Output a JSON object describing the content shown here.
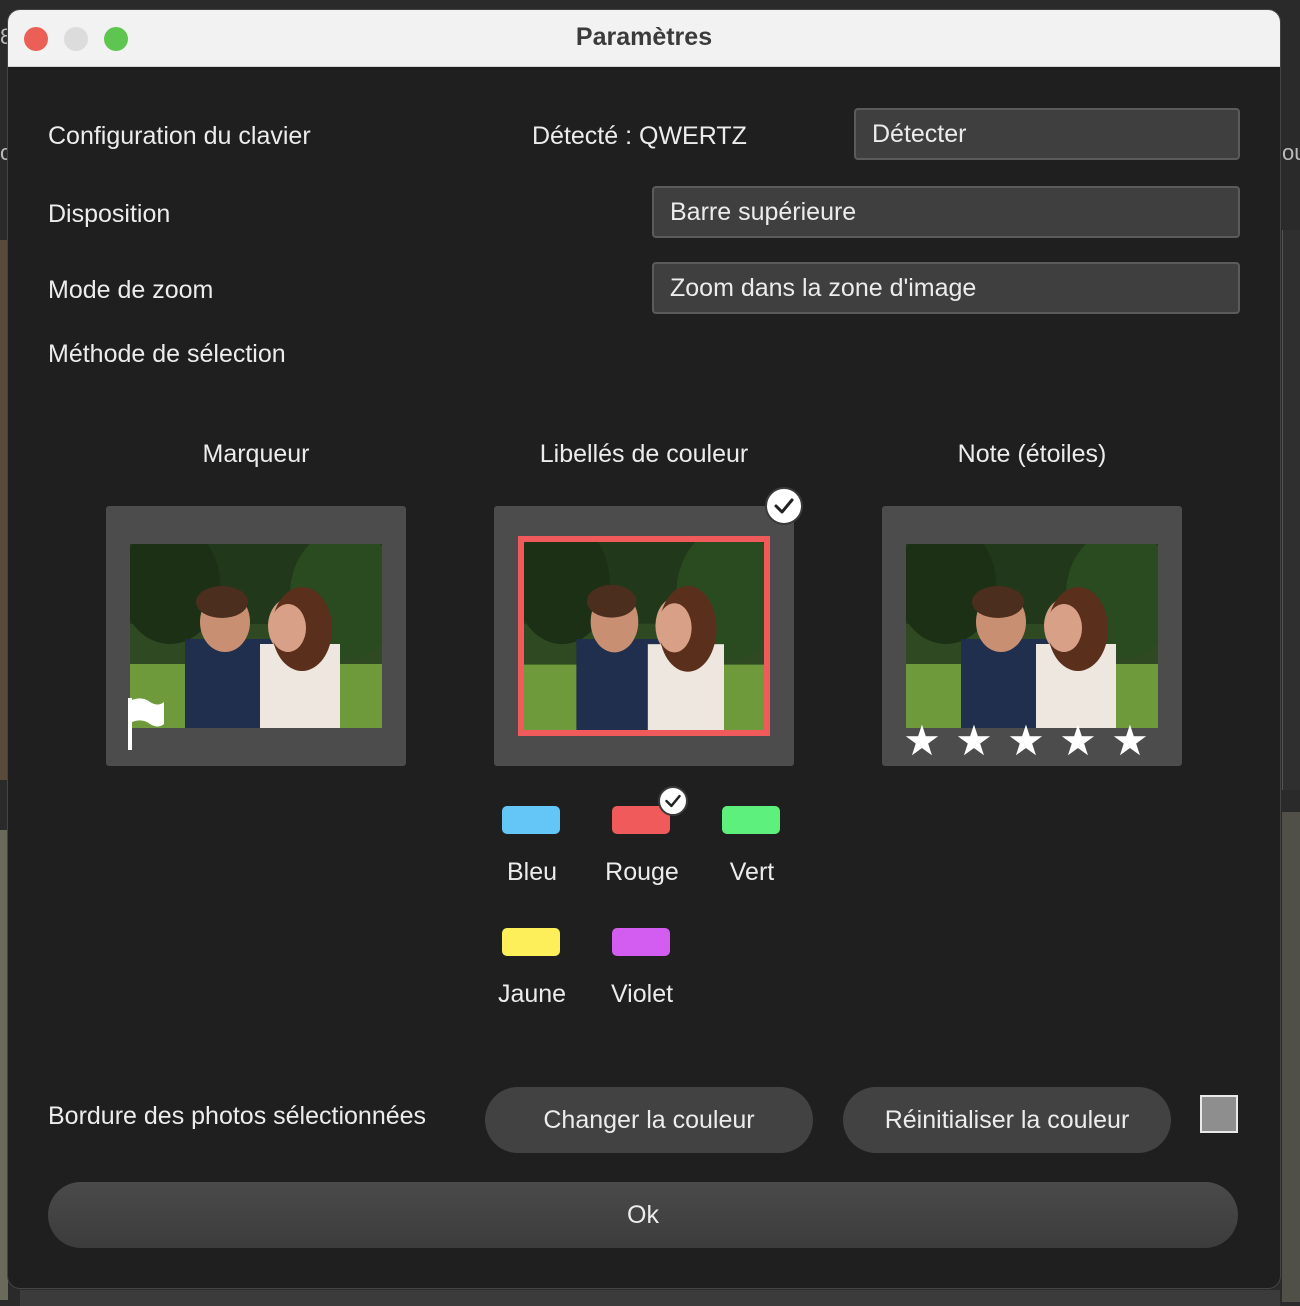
{
  "window": {
    "title": "Paramètres"
  },
  "rows": {
    "keyboard": {
      "label": "Configuration du clavier",
      "detected": "Détecté : QWERTZ",
      "button": "Détecter"
    },
    "layout": {
      "label": "Disposition",
      "value": "Barre supérieure"
    },
    "zoom": {
      "label": "Mode de zoom",
      "value": "Zoom dans la zone d'image"
    },
    "selection": {
      "label": "Méthode de sélection"
    }
  },
  "methods": [
    {
      "title": "Marqueur",
      "icon": "flag-icon"
    },
    {
      "title": "Libellés de couleur",
      "selected": true,
      "border_color": "#f05a5a"
    },
    {
      "title": "Note (étoiles)",
      "stars": 5
    }
  ],
  "colors": [
    {
      "label": "Bleu",
      "color": "#63c6f7"
    },
    {
      "label": "Rouge",
      "color": "#f05a5a",
      "selected": true
    },
    {
      "label": "Vert",
      "color": "#5ef07c"
    },
    {
      "label": "Jaune",
      "color": "#fcef5a"
    },
    {
      "label": "Violet",
      "color": "#d35df0"
    }
  ],
  "border": {
    "label": "Bordure des photos sélectionnées",
    "change_button": "Changer la couleur",
    "reset_button": "Réinitialiser la couleur",
    "preview_color": "#8e8e8e"
  },
  "ok_button": "Ok",
  "edge_text": {
    "left_top": "8",
    "left_mid": "c",
    "right_mid": "ou"
  }
}
